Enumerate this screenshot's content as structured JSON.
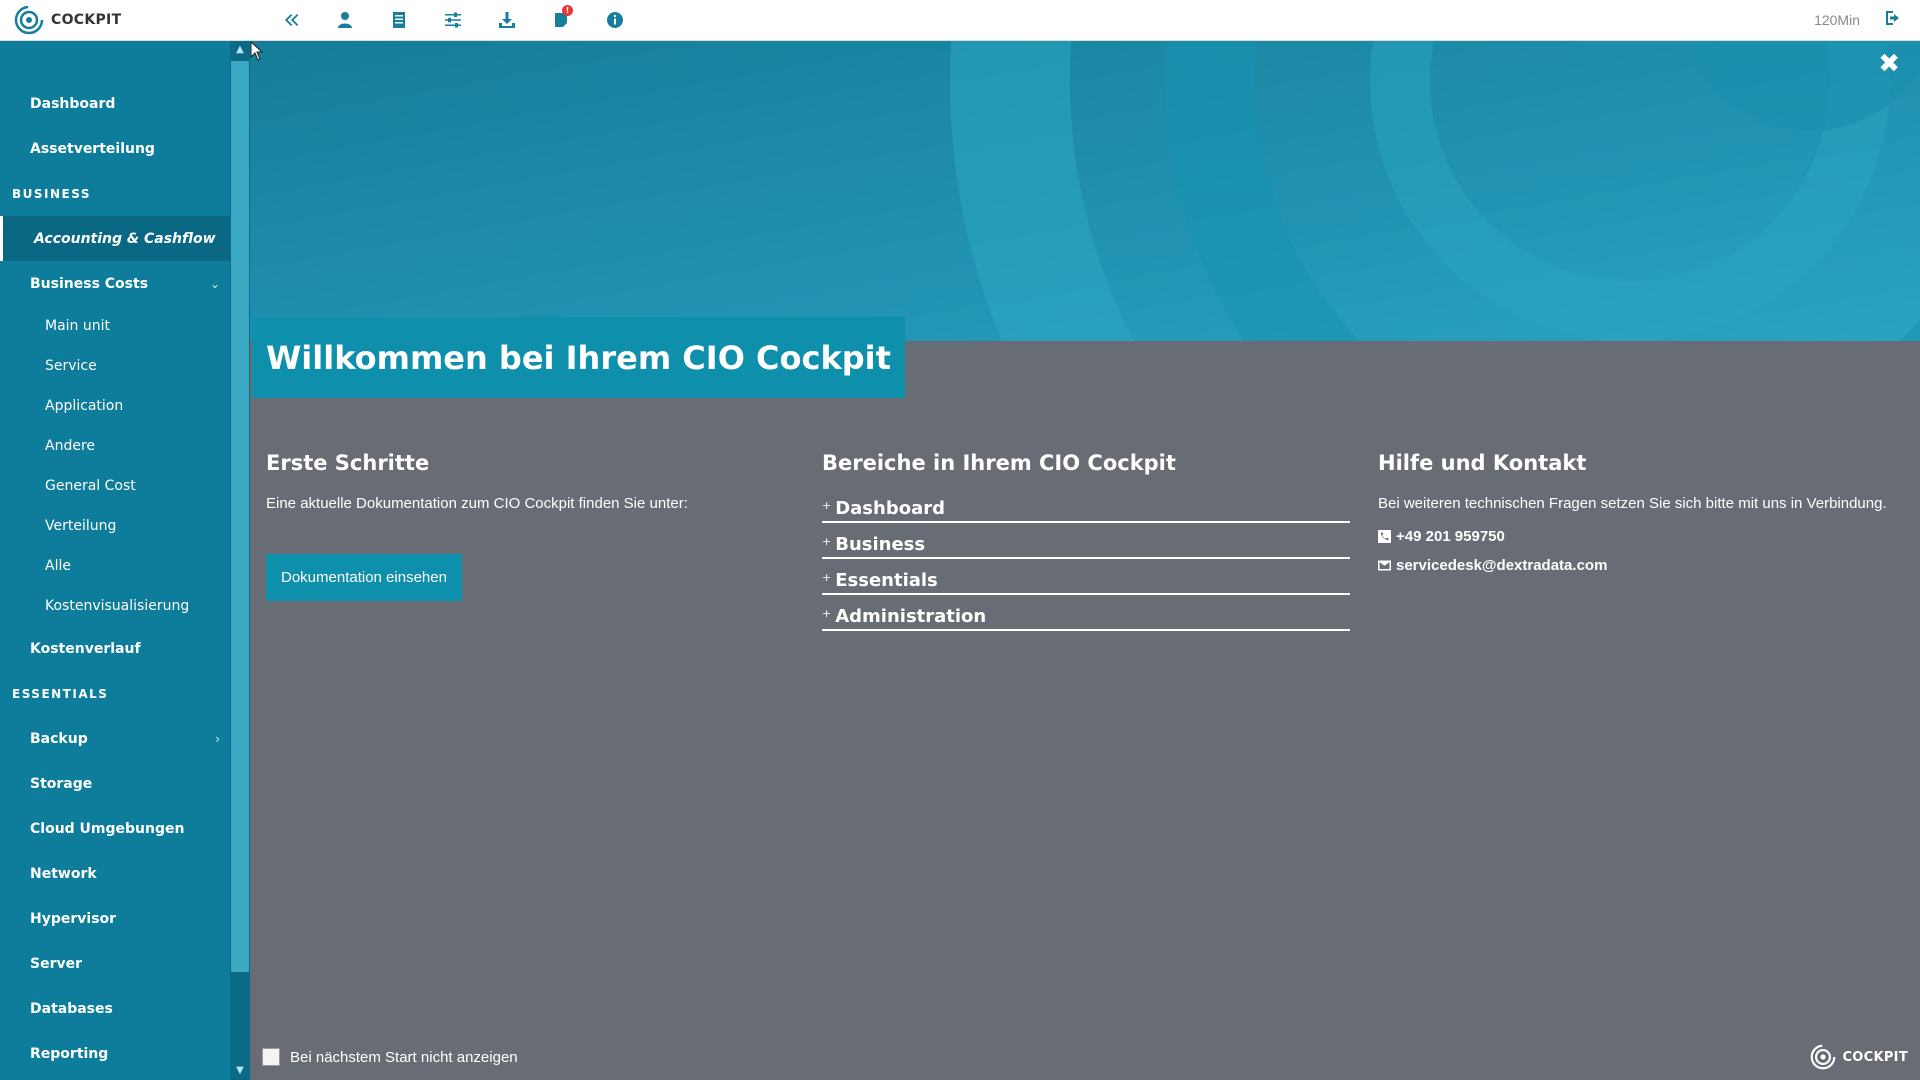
{
  "app": {
    "logo_text": "COCKPIT",
    "timer": "120Min",
    "notification_count": "!"
  },
  "toolbar": {
    "icons": [
      "collapse-sidebar-icon",
      "user-icon",
      "document-icon",
      "sliders-icon",
      "download-icon",
      "notifications-icon",
      "info-icon",
      "logout-icon"
    ]
  },
  "sidebar": {
    "items": [
      {
        "type": "item",
        "label": "Dashboard"
      },
      {
        "type": "item",
        "label": "Assetverteilung"
      },
      {
        "type": "section",
        "label": "BUSINESS"
      },
      {
        "type": "active",
        "label": "Accounting & Cashflow"
      },
      {
        "type": "item",
        "label": "Business Costs",
        "caret": "⌄"
      },
      {
        "type": "sub",
        "label": "Main unit"
      },
      {
        "type": "sub",
        "label": "Service"
      },
      {
        "type": "sub",
        "label": "Application"
      },
      {
        "type": "sub",
        "label": "Andere"
      },
      {
        "type": "sub",
        "label": "General Cost"
      },
      {
        "type": "sub",
        "label": "Verteilung"
      },
      {
        "type": "sub",
        "label": "Alle"
      },
      {
        "type": "sub",
        "label": "Kostenvisualisierung"
      },
      {
        "type": "item",
        "label": "Kostenverlauf"
      },
      {
        "type": "section",
        "label": "ESSENTIALS"
      },
      {
        "type": "item",
        "label": "Backup",
        "caret": "›"
      },
      {
        "type": "item",
        "label": "Storage"
      },
      {
        "type": "item",
        "label": "Cloud Umgebungen"
      },
      {
        "type": "item",
        "label": "Network"
      },
      {
        "type": "item",
        "label": "Hypervisor"
      },
      {
        "type": "item",
        "label": "Server"
      },
      {
        "type": "item",
        "label": "Databases"
      },
      {
        "type": "item",
        "label": "Reporting"
      }
    ]
  },
  "dialog": {
    "title": "Willkommen bei Ihrem CIO Cockpit",
    "first_steps": {
      "heading": "Erste Schritte",
      "text": "Eine aktuelle Dokumentation zum CIO Cockpit finden Sie unter:",
      "button": "Dokumentation einsehen"
    },
    "areas": {
      "heading": "Bereiche in Ihrem CIO Cockpit",
      "items": [
        "Dashboard",
        "Business",
        "Essentials",
        "Administration"
      ]
    },
    "help": {
      "heading": "Hilfe und Kontakt",
      "text": "Bei weiteren technischen Fragen setzen Sie sich bitte mit uns in Verbindung.",
      "phone": "+49 201 959750",
      "email": "servicedesk@dextradata.com"
    },
    "footer_checkbox_label": "Bei nächstem Start nicht anzeigen",
    "footer_logo_text": "COCKPIT",
    "close_label": "✖"
  },
  "colors": {
    "accent": "#0e8fac",
    "sidebar_bg": "#0d7d9b",
    "dialog_bg": "#686c74"
  }
}
